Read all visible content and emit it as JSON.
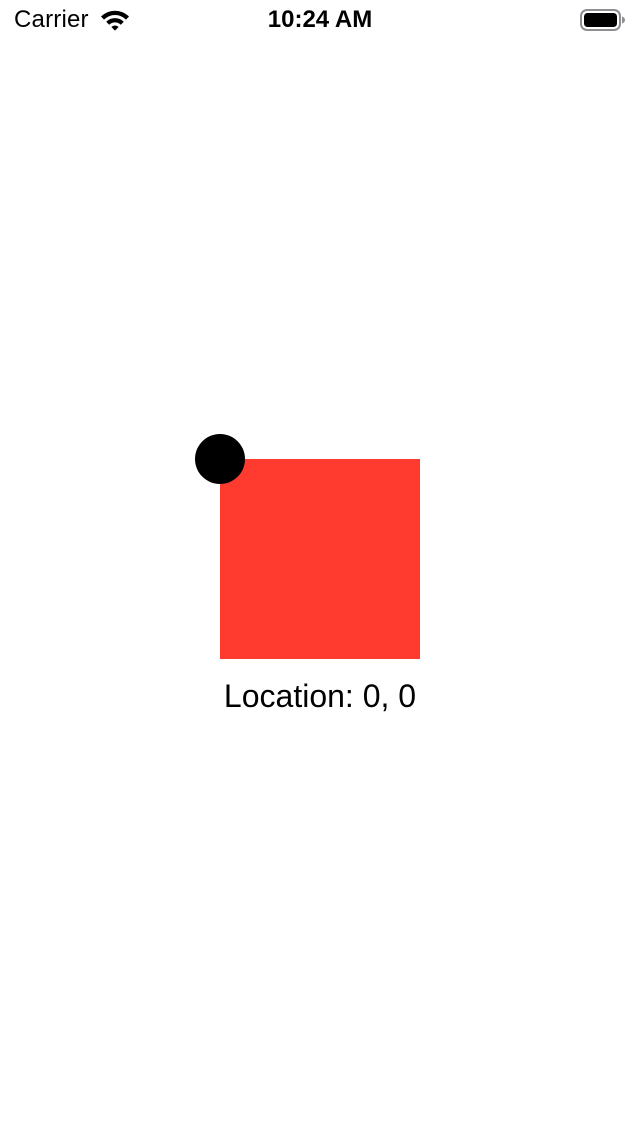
{
  "status_bar": {
    "carrier": "Carrier",
    "time": "10:24 AM",
    "wifi_icon": "wifi-icon",
    "battery_icon": "battery-icon"
  },
  "canvas": {
    "square_color": "#FF3B30",
    "handle_color": "#000000",
    "location_text": "Location: 0, 0"
  }
}
